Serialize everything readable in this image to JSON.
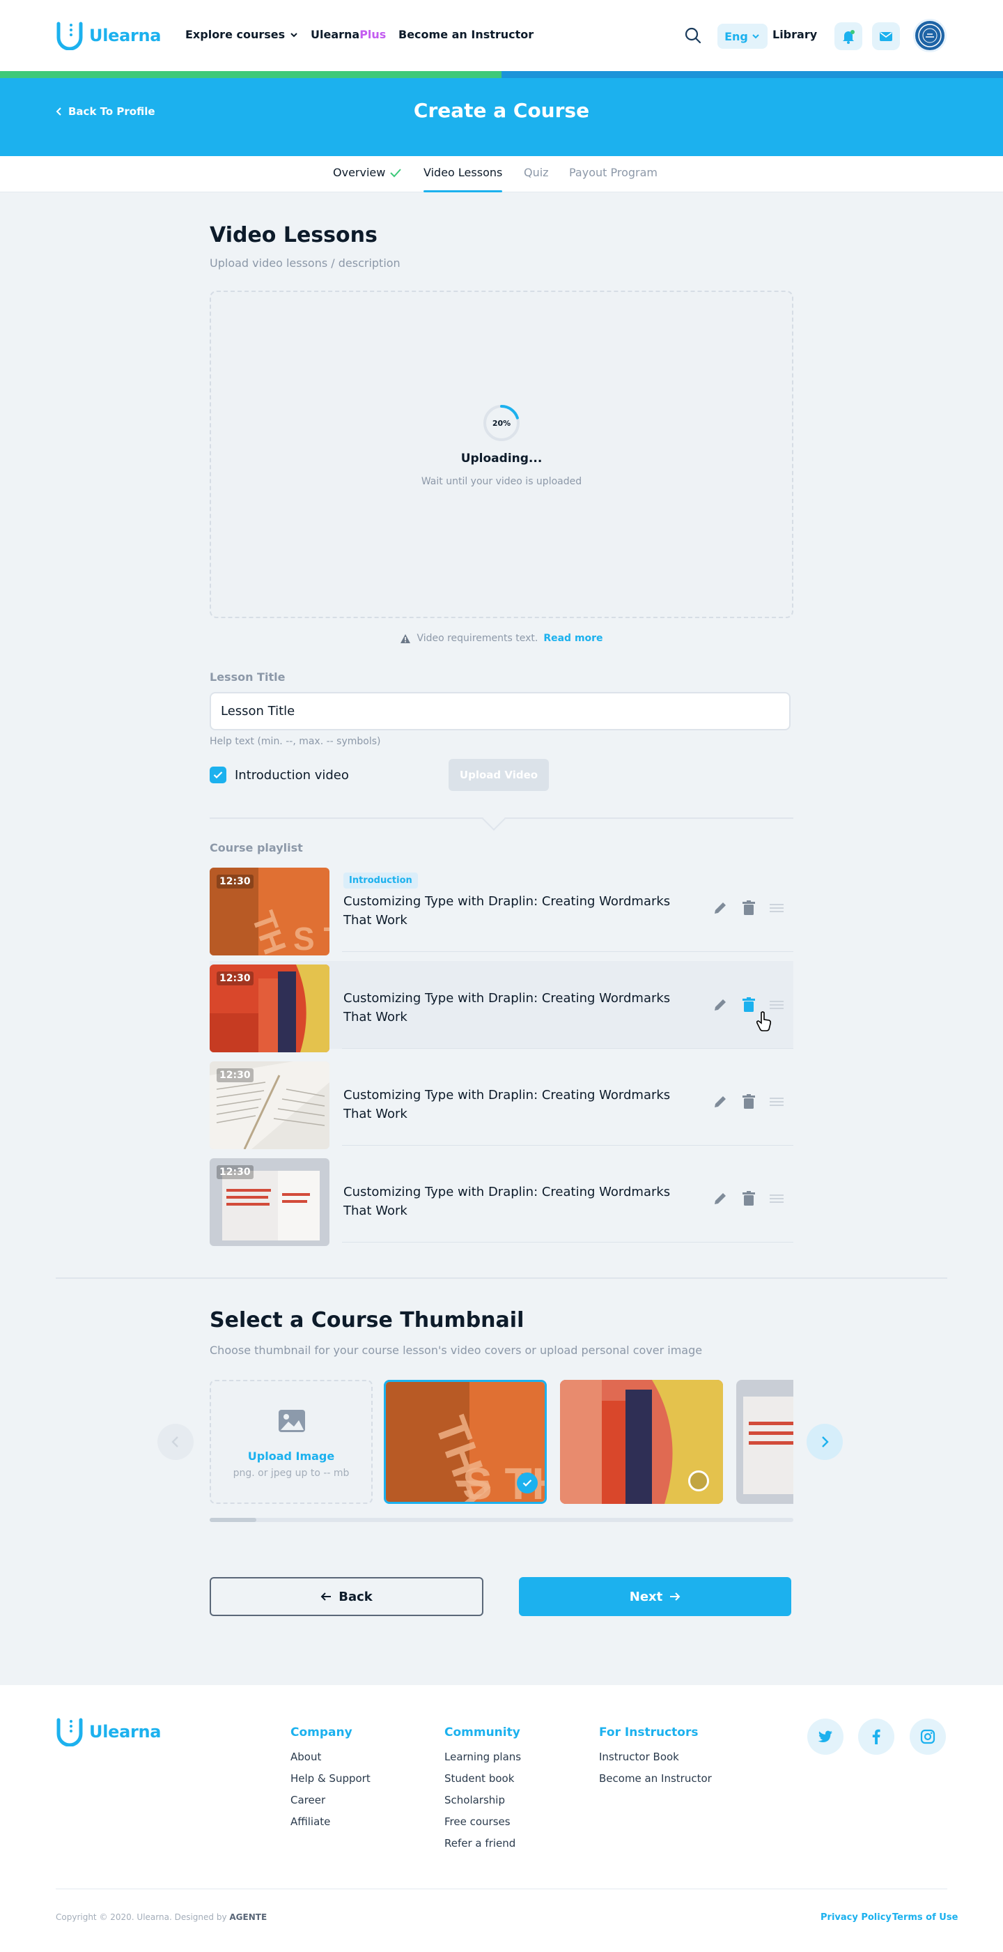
{
  "header": {
    "logo_text": "Ulearna",
    "nav": {
      "explore": "Explore courses",
      "plus_prefix": "Ulearna",
      "plus_suffix": "Plus",
      "instructor": "Become an Instructor"
    },
    "language": "Eng",
    "library": "Library"
  },
  "banner": {
    "back_label": "Back To Profile",
    "title": "Create a Course"
  },
  "steps": {
    "overview": "Overview",
    "video_lessons": "Video Lessons",
    "quiz": "Quiz",
    "payout": "Payout Program",
    "progress_fraction": 0.5
  },
  "video_section": {
    "title": "Video Lessons",
    "subtitle": "Upload video lessons / description",
    "upload_percent": "20%",
    "upload_fraction": 0.2,
    "uploading_title": "Uploading...",
    "uploading_hint": "Wait until your video is uploaded",
    "requirements_text": "Video requirements text.",
    "read_more": "Read more"
  },
  "lesson_form": {
    "label": "Lesson Title",
    "value": "Lesson Title",
    "help": "Help text (min. --, max. -- symbols)",
    "intro_checkbox_label": "Introduction video",
    "upload_button": "Upload Video"
  },
  "playlist": {
    "label": "Course playlist",
    "items": [
      {
        "duration": "12:30",
        "badge": "Introduction",
        "title": "Customizing Type with Draplin: Creating Wordmarks That Work"
      },
      {
        "duration": "12:30",
        "badge": "",
        "title": "Customizing Type with Draplin: Creating Wordmarks That Work"
      },
      {
        "duration": "12:30",
        "badge": "",
        "title": "Customizing Type with Draplin: Creating Wordmarks That Work"
      },
      {
        "duration": "12:30",
        "badge": "",
        "title": "Customizing Type with Draplin: Creating Wordmarks That Work"
      }
    ]
  },
  "thumbnail_section": {
    "title": "Select a Course Thumbnail",
    "subtitle": "Choose thumbnail for your course lesson's video covers or upload personal cover image",
    "upload_label": "Upload Image",
    "upload_hint": "png. or jpeg up to -- mb",
    "scroll_fraction": 0.08
  },
  "actions": {
    "back": "Back",
    "next": "Next"
  },
  "footer": {
    "logo_text": "Ulearna",
    "columns": [
      {
        "title": "Company",
        "links": [
          "About",
          "Help & Support",
          "Career",
          "Affiliate"
        ]
      },
      {
        "title": "Community",
        "links": [
          "Learning plans",
          "Student book",
          "Scholarship",
          "Free courses",
          "Refer a friend"
        ]
      },
      {
        "title": "For Instructors",
        "links": [
          "Instructor Book",
          "Become an Instructor"
        ]
      }
    ],
    "copyright": "Copyright © 2020. Ulearna. Designed by",
    "designer": "AGENTE",
    "privacy": "Privacy Policy",
    "terms": "Terms of Use"
  },
  "colors": {
    "brand": "#1cb1ee",
    "success": "#3ec97a",
    "plus": "#c35cf0",
    "page_bg": "#eff3f6"
  },
  "icons": [
    "search-icon",
    "bell-icon",
    "mail-icon",
    "chevron-down-icon",
    "check-icon",
    "edit-icon",
    "trash-icon",
    "drag-icon",
    "image-icon",
    "twitter-icon",
    "facebook-icon",
    "instagram-icon"
  ]
}
